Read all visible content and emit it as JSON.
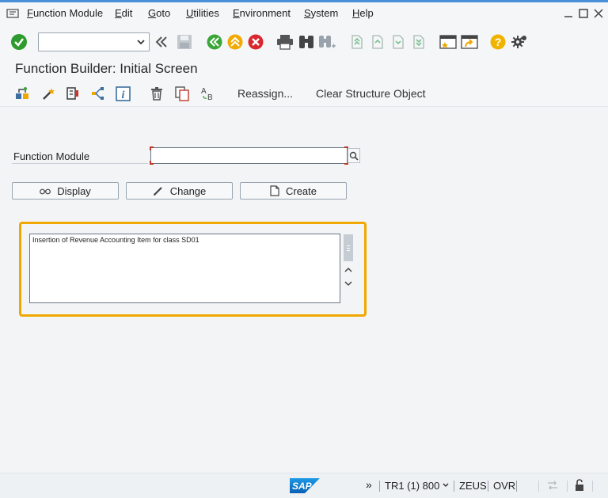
{
  "menu": {
    "items": [
      "Function Module",
      "Edit",
      "Goto",
      "Utilities",
      "Environment",
      "System",
      "Help"
    ]
  },
  "system_toolbar": {
    "command_field_value": "",
    "icons": [
      "enter-icon",
      "command-dropdown-icon",
      "collapse-left-icon",
      "save-icon",
      "back-icon",
      "exit-icon",
      "cancel-icon",
      "print-icon",
      "find-icon",
      "find-next-icon",
      "first-page-icon",
      "previous-page-icon",
      "next-page-icon",
      "last-page-icon",
      "create-session-icon",
      "shortcut-icon",
      "help-icon",
      "settings-icon"
    ]
  },
  "screen_title": "Function Builder: Initial Screen",
  "app_toolbar": {
    "reassign_label": "Reassign...",
    "clear_structure_label": "Clear Structure Object"
  },
  "form": {
    "function_module_label": "Function Module",
    "function_module_value": "",
    "display_label": "Display",
    "change_label": "Change",
    "create_label": "Create"
  },
  "short_text": "Insertion of Revenue Accounting Item for class SD01",
  "status_bar": {
    "logo_text": "SAP",
    "session": "TR1 (1) 800",
    "server": "ZEUS",
    "mode": "OVR"
  },
  "colors": {
    "accent_blue": "#4a90d9",
    "highlight_orange": "#f0a800",
    "enter_green": "#2e9b2e",
    "back_green": "#3aa63a",
    "exit_orange": "#f2a900",
    "cancel_red": "#d9272e",
    "help_yellow": "#f0b400",
    "required_red": "#c0392b"
  }
}
